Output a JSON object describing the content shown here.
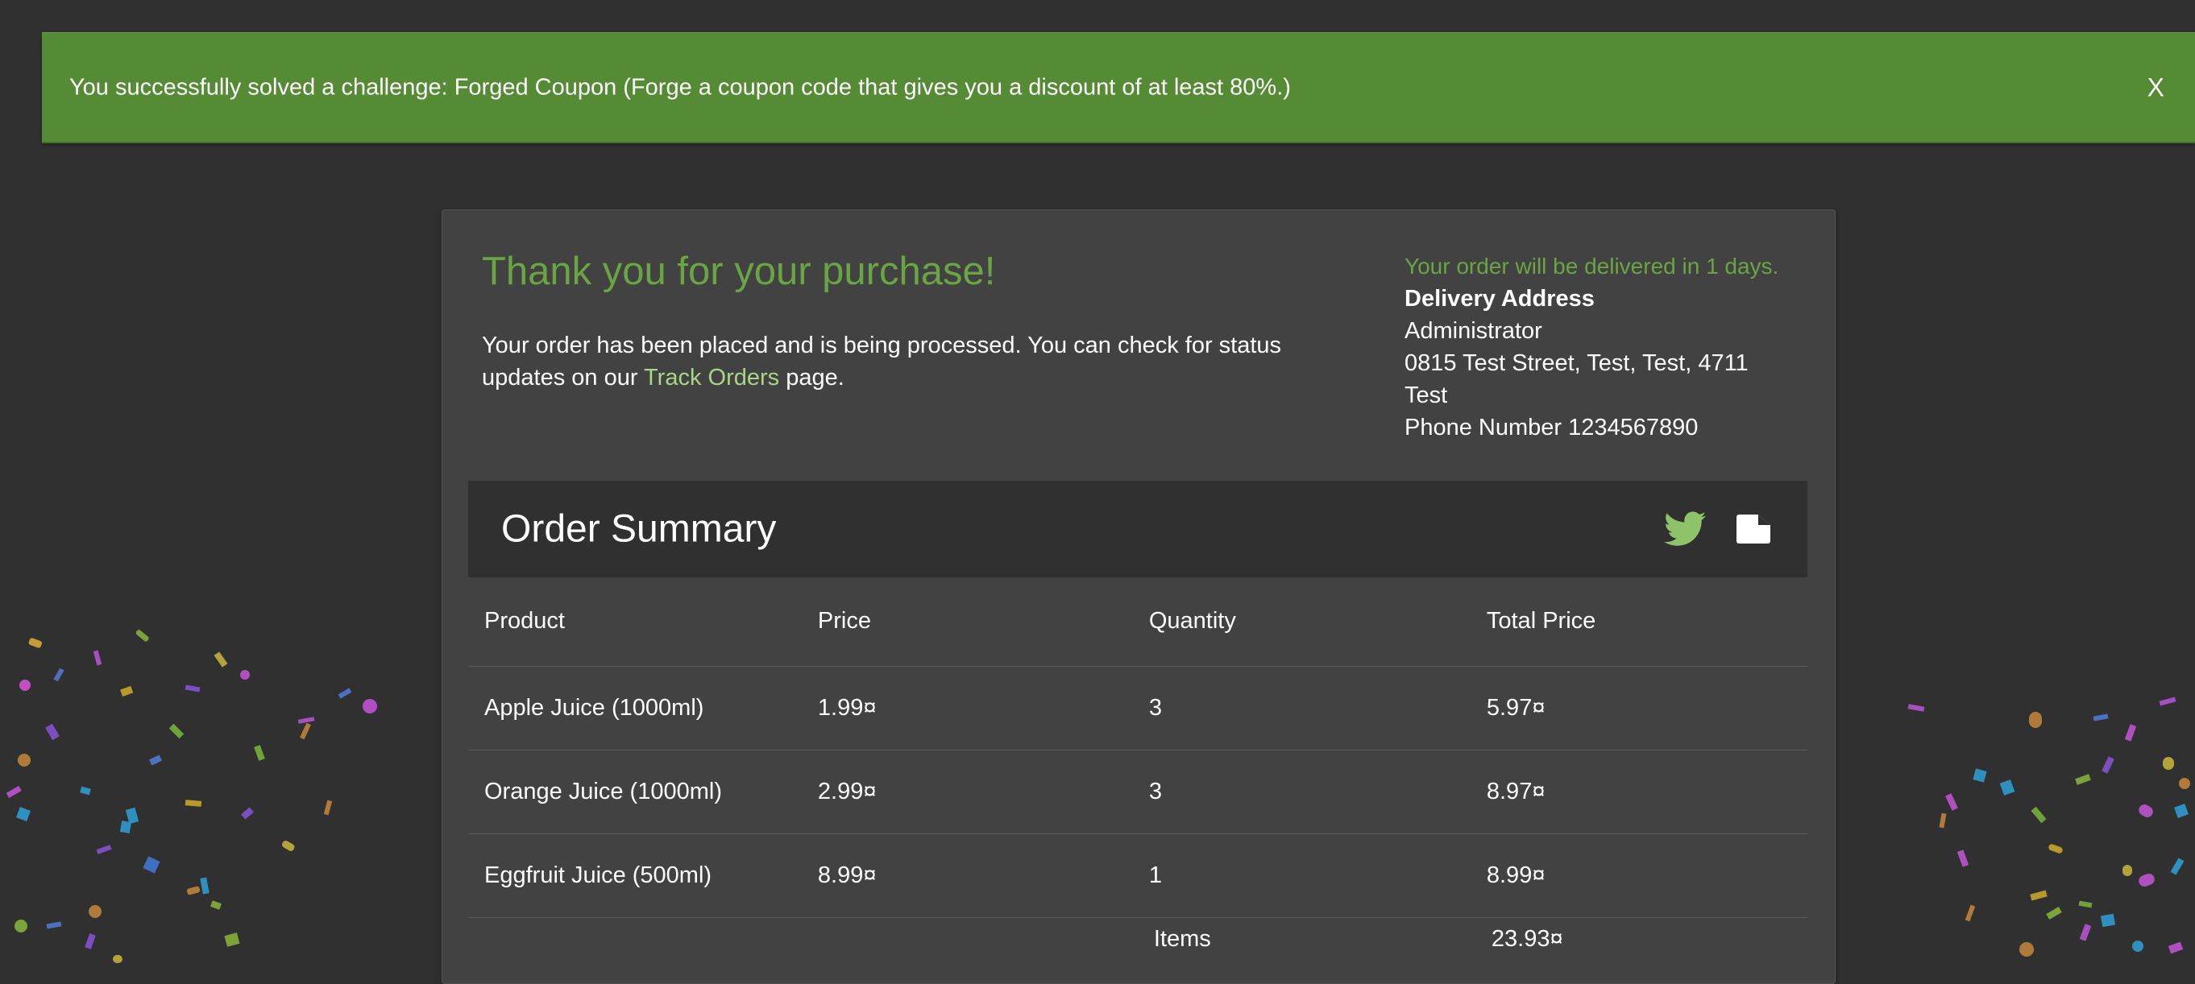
{
  "notification": {
    "message": "You successfully solved a challenge: Forged Coupon (Forge a coupon code that gives you a discount of at least 80%.)",
    "close_label": "X",
    "color": "#558b34"
  },
  "confirmation": {
    "title": "Thank you for your purchase!",
    "message_before_link": "Your order has been placed and is being processed. You can check for status updates on our ",
    "link_label": "Track Orders",
    "message_after_link": " page."
  },
  "delivery": {
    "note": "Your order will be delivered in 1 days.",
    "heading": "Delivery Address",
    "name": "Administrator",
    "address_line": "0815 Test Street, Test, Test, 4711",
    "country": "Test",
    "phone": "Phone Number 1234567890"
  },
  "summary": {
    "title": "Order Summary",
    "share_icon": "twitter-icon",
    "print_icon": "pdf-document-icon",
    "columns": [
      "Product",
      "Price",
      "Quantity",
      "Total Price"
    ],
    "rows": [
      {
        "product": "Apple Juice (1000ml)",
        "price": "1.99¤",
        "quantity": "3",
        "total": "5.97¤"
      },
      {
        "product": "Orange Juice (1000ml)",
        "price": "2.99¤",
        "quantity": "3",
        "total": "8.97¤"
      },
      {
        "product": "Eggfruit Juice (500ml)",
        "price": "8.99¤",
        "quantity": "1",
        "total": "8.99¤"
      }
    ],
    "totals": {
      "label": "Items",
      "value": "23.93¤"
    }
  },
  "colors": {
    "background": "#303030",
    "card": "#424242",
    "accent_green": "#6aa544",
    "link_green": "#a9d686"
  }
}
